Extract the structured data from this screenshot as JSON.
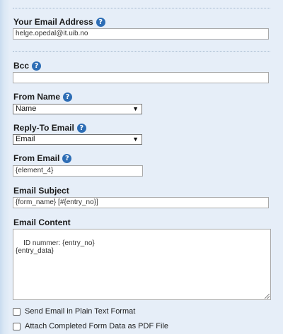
{
  "email_address": {
    "label": "Your Email Address",
    "value": "helge.opedal@it.uib.no"
  },
  "bcc": {
    "label": "Bcc",
    "value": ""
  },
  "from_name": {
    "label": "From Name",
    "selected": "Name"
  },
  "reply_to": {
    "label": "Reply-To Email",
    "selected": "Email"
  },
  "from_email": {
    "label": "From Email",
    "value": "{element_4}"
  },
  "subject": {
    "label": "Email Subject",
    "value": "{form_name} [#{entry_no}]"
  },
  "content": {
    "label": "Email Content",
    "value": "ID nummer: {entry_no}\n{entry_data}"
  },
  "options": {
    "plain_text_label": "Send Email in Plain Text Format",
    "plain_text_checked": false,
    "attach_pdf_label": "Attach Completed Form Data as PDF File",
    "attach_pdf_checked": false
  },
  "icons": {
    "help": "?"
  },
  "colors": {
    "help_icon": "#2d6db5",
    "background": "#e6eef8"
  }
}
